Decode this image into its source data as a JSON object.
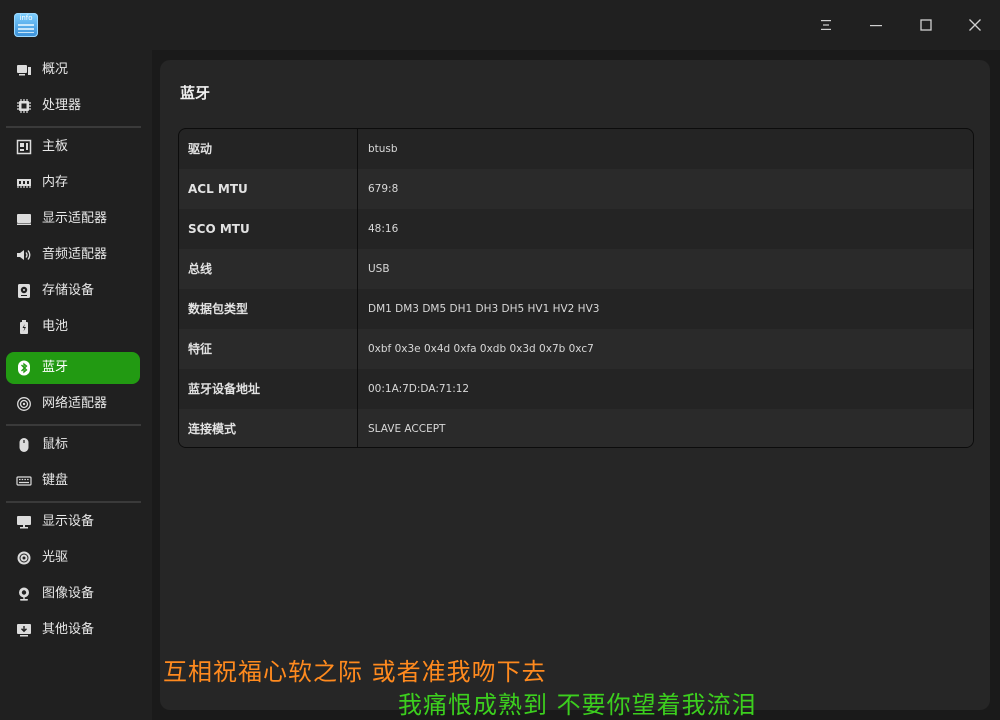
{
  "app": {
    "icon_text": "info"
  },
  "colors": {
    "accent": "#229a12",
    "subtitle_line1": "#ff8a1e",
    "subtitle_line2": "#3ccf1e"
  },
  "window_controls": {
    "menu_icon": "menu-icon",
    "minimize_icon": "minimize-icon",
    "maximize_icon": "maximize-icon",
    "close_icon": "close-icon"
  },
  "sidebar": {
    "items": [
      {
        "label": "概况",
        "icon": "overview-icon"
      },
      {
        "label": "处理器",
        "icon": "cpu-icon"
      },
      {
        "label": "主板",
        "icon": "motherboard-icon"
      },
      {
        "label": "内存",
        "icon": "memory-icon"
      },
      {
        "label": "显示适配器",
        "icon": "display-adapter-icon"
      },
      {
        "label": "音频适配器",
        "icon": "audio-adapter-icon"
      },
      {
        "label": "存储设备",
        "icon": "storage-icon"
      },
      {
        "label": "电池",
        "icon": "battery-icon"
      },
      {
        "label": "蓝牙",
        "icon": "bluetooth-icon",
        "active": true
      },
      {
        "label": "网络适配器",
        "icon": "network-adapter-icon"
      },
      {
        "label": "鼠标",
        "icon": "mouse-icon"
      },
      {
        "label": "键盘",
        "icon": "keyboard-icon"
      },
      {
        "label": "显示设备",
        "icon": "monitor-icon"
      },
      {
        "label": "光驱",
        "icon": "optical-drive-icon"
      },
      {
        "label": "图像设备",
        "icon": "camera-icon"
      },
      {
        "label": "其他设备",
        "icon": "other-devices-icon"
      }
    ]
  },
  "main": {
    "title": "蓝牙",
    "rows": [
      {
        "key": "驱动",
        "value": "btusb"
      },
      {
        "key": "ACL MTU",
        "value": "679:8"
      },
      {
        "key": "SCO MTU",
        "value": "48:16"
      },
      {
        "key": "总线",
        "value": "USB"
      },
      {
        "key": "数据包类型",
        "value": "DM1 DM3 DM5 DH1 DH3 DH5 HV1 HV2 HV3"
      },
      {
        "key": "特征",
        "value": "0xbf 0x3e 0x4d 0xfa 0xdb 0x3d 0x7b 0xc7"
      },
      {
        "key": "蓝牙设备地址",
        "value": "00:1A:7D:DA:71:12"
      },
      {
        "key": "连接模式",
        "value": "SLAVE ACCEPT"
      }
    ]
  },
  "subtitles": {
    "line1": "互相祝福心软之际  或者准我吻下去",
    "line2": "我痛恨成熟到  不要你望着我流泪"
  }
}
